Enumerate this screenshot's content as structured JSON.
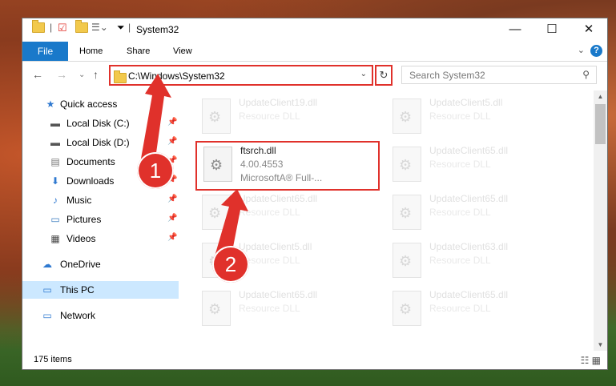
{
  "window": {
    "title": "System32",
    "minimize_glyph": "—",
    "maximize_glyph": "☐",
    "close_glyph": "✕"
  },
  "ribbon": {
    "tabs": [
      "File",
      "Home",
      "Share",
      "View"
    ],
    "help_glyph": "?",
    "expand_glyph": "⌄"
  },
  "nav": {
    "back_glyph": "←",
    "forward_glyph": "→",
    "recent_glyph": "⌄",
    "up_glyph": "↑",
    "address": "C:\\Windows\\System32",
    "address_dropdown_glyph": "⌄",
    "refresh_glyph": "↻",
    "search_placeholder": "Search System32",
    "search_glyph": "⚲"
  },
  "sidebar": {
    "items": [
      {
        "label": "Quick access",
        "icon": "star-icon"
      },
      {
        "label": "Local Disk (C:)",
        "icon": "drive-icon",
        "pinned": true
      },
      {
        "label": "Local Disk (D:)",
        "icon": "drive-icon",
        "pinned": true
      },
      {
        "label": "Documents",
        "icon": "documents-icon",
        "pinned": true
      },
      {
        "label": "Downloads",
        "icon": "download-icon",
        "pinned": true
      },
      {
        "label": "Music",
        "icon": "music-icon",
        "pinned": true
      },
      {
        "label": "Pictures",
        "icon": "pictures-icon",
        "pinned": true
      },
      {
        "label": "Videos",
        "icon": "videos-icon",
        "pinned": true
      },
      {
        "label": "OneDrive",
        "icon": "cloud-icon"
      },
      {
        "label": "This PC",
        "icon": "computer-icon",
        "selected": true
      },
      {
        "label": "Network",
        "icon": "network-icon"
      }
    ]
  },
  "files": {
    "f1": {
      "name": "UpdateClient19.dll",
      "desc": "Resource DLL"
    },
    "f2": {
      "name": "UpdateClient5.dll",
      "desc": "Resource DLL"
    },
    "f3": {
      "name": "ftsrch.dll",
      "version": "4.00.4553",
      "desc": "MicrosoftA® Full-..."
    },
    "f4": {
      "name": "UpdateClient65.dll",
      "desc": "Resource DLL"
    },
    "f5": {
      "name": "UpdateClient65.dll",
      "desc": "Resource DLL"
    },
    "f6": {
      "name": "UpdateClient65.dll",
      "desc": "Resource DLL"
    },
    "f7": {
      "name": "UpdateClient5.dll",
      "desc": "Resource DLL"
    },
    "f8": {
      "name": "UpdateClient63.dll",
      "desc": "Resource DLL"
    },
    "f9": {
      "name": "UpdateClient65.dll",
      "desc": "Resource DLL"
    },
    "f10": {
      "name": "UpdateClient65.dll",
      "desc": "Resource DLL"
    }
  },
  "status": {
    "item_count": "175 items",
    "view_glyphs": "☷ ▦"
  },
  "annotations": {
    "step1": "1",
    "step2": "2",
    "color": "#e0312b"
  }
}
